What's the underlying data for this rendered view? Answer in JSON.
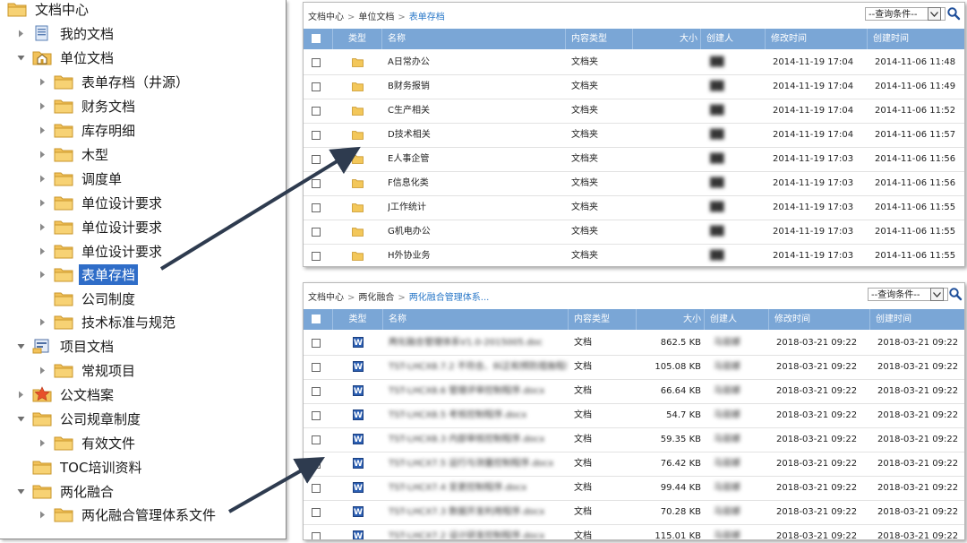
{
  "colors": {
    "header_bg": "#7aa6d6",
    "selection": "#2f6dc8",
    "link": "#2a78c8",
    "folder": "#f2c25a",
    "arrow": "#2e3b4f"
  },
  "tree": {
    "nodes": [
      {
        "label": "文档中心",
        "icon": "folder-icon",
        "caret": "none"
      },
      {
        "label": "我的文档",
        "icon": "my-documents-icon",
        "caret": "right"
      },
      {
        "label": "单位文档",
        "icon": "unit-documents-icon",
        "caret": "down"
      },
      {
        "label": "表单存档（井源）",
        "icon": "folder-icon",
        "caret": "right"
      },
      {
        "label": "财务文档",
        "icon": "folder-icon",
        "caret": "right"
      },
      {
        "label": "库存明细",
        "icon": "folder-icon",
        "caret": "right"
      },
      {
        "label": "木型",
        "icon": "folder-icon",
        "caret": "right"
      },
      {
        "label": "调度单",
        "icon": "folder-icon",
        "caret": "right"
      },
      {
        "label": "单位设计要求",
        "icon": "folder-icon",
        "caret": "right"
      },
      {
        "label": "单位设计要求",
        "icon": "folder-icon",
        "caret": "right"
      },
      {
        "label": "单位设计要求",
        "icon": "folder-icon",
        "caret": "right"
      },
      {
        "label": "表单存档",
        "icon": "folder-icon",
        "caret": "right",
        "selected": true
      },
      {
        "label": "公司制度",
        "icon": "folder-icon",
        "caret": "none"
      },
      {
        "label": "技术标准与规范",
        "icon": "folder-icon",
        "caret": "right"
      },
      {
        "label": "项目文档",
        "icon": "project-documents-icon",
        "caret": "down"
      },
      {
        "label": "常规项目",
        "icon": "folder-icon",
        "caret": "right"
      },
      {
        "label": "公文档案",
        "icon": "star-icon",
        "caret": "right"
      },
      {
        "label": "公司规章制度",
        "icon": "folder-icon",
        "caret": "down"
      },
      {
        "label": "有效文件",
        "icon": "folder-icon",
        "caret": "right"
      },
      {
        "label": "TOC培训资料",
        "icon": "folder-icon",
        "caret": "none"
      },
      {
        "label": "两化融合",
        "icon": "folder-icon",
        "caret": "down"
      },
      {
        "label": "两化融合管理体系文件",
        "icon": "folder-icon",
        "caret": "right"
      }
    ]
  },
  "panel1": {
    "breadcrumb": [
      "文档中心",
      "单位文档",
      "表单存档"
    ],
    "query_label": "--查询条件--",
    "columns": [
      "类型",
      "名称",
      "内容类型",
      "大小",
      "创建人",
      "修改时间",
      "创建时间"
    ],
    "rows": [
      {
        "name": "A日常办公",
        "content_type": "文档夹",
        "size": "",
        "creator": "██",
        "modified": "2014-11-19 17:04",
        "created": "2014-11-06 11:48"
      },
      {
        "name": "B财务报销",
        "content_type": "文档夹",
        "size": "",
        "creator": "██",
        "modified": "2014-11-19 17:04",
        "created": "2014-11-06 11:49"
      },
      {
        "name": "C生产相关",
        "content_type": "文档夹",
        "size": "",
        "creator": "██",
        "modified": "2014-11-19 17:04",
        "created": "2014-11-06 11:52"
      },
      {
        "name": "D技术相关",
        "content_type": "文档夹",
        "size": "",
        "creator": "██",
        "modified": "2014-11-19 17:04",
        "created": "2014-11-06 11:57"
      },
      {
        "name": "E人事企管",
        "content_type": "文档夹",
        "size": "",
        "creator": "██",
        "modified": "2014-11-19 17:03",
        "created": "2014-11-06 11:56"
      },
      {
        "name": "F信息化类",
        "content_type": "文档夹",
        "size": "",
        "creator": "██",
        "modified": "2014-11-19 17:03",
        "created": "2014-11-06 11:56"
      },
      {
        "name": "J工作统计",
        "content_type": "文档夹",
        "size": "",
        "creator": "██",
        "modified": "2014-11-19 17:03",
        "created": "2014-11-06 11:55"
      },
      {
        "name": "G机电办公",
        "content_type": "文档夹",
        "size": "",
        "creator": "██",
        "modified": "2014-11-19 17:03",
        "created": "2014-11-06 11:55"
      },
      {
        "name": "H外协业务",
        "content_type": "文档夹",
        "size": "",
        "creator": "██",
        "modified": "2014-11-19 17:03",
        "created": "2014-11-06 11:55"
      }
    ]
  },
  "panel2": {
    "breadcrumb": [
      "文档中心",
      "两化融合",
      "两化融合管理体系..."
    ],
    "query_label": "--查询条件--",
    "columns": [
      "类型",
      "名称",
      "内容类型",
      "大小",
      "创建人",
      "修改时间",
      "创建时间"
    ],
    "rows": [
      {
        "name": "两化融合管理体系V1.0-2015005.doc",
        "content_type": "文档",
        "size": "862.5 KB",
        "creator": "马丽娜",
        "modified": "2018-03-21 09:22",
        "created": "2018-03-21 09:22"
      },
      {
        "name": "TST-LHCX8.7.2 不符合、纠正和预防措施程序.doc",
        "content_type": "文档",
        "size": "105.08 KB",
        "creator": "马丽娜",
        "modified": "2018-03-21 09:22",
        "created": "2018-03-21 09:22"
      },
      {
        "name": "TST-LHCX8.6 管理评审控制程序.docx",
        "content_type": "文档",
        "size": "66.64 KB",
        "creator": "马丽娜",
        "modified": "2018-03-21 09:22",
        "created": "2018-03-21 09:22"
      },
      {
        "name": "TST-LHCX8.5 考核控制程序.docx",
        "content_type": "文档",
        "size": "54.7 KB",
        "creator": "马丽娜",
        "modified": "2018-03-21 09:22",
        "created": "2018-03-21 09:22"
      },
      {
        "name": "TST-LHCX8.3 内部审核控制程序.docx",
        "content_type": "文档",
        "size": "59.35 KB",
        "creator": "马丽娜",
        "modified": "2018-03-21 09:22",
        "created": "2018-03-21 09:22"
      },
      {
        "name": "TST-LHCX7.5 运行与测量控制程序.docx",
        "content_type": "文档",
        "size": "76.42 KB",
        "creator": "马丽娜",
        "modified": "2018-03-21 09:22",
        "created": "2018-03-21 09:22"
      },
      {
        "name": "TST-LHCX7.4 变更控制程序.docx",
        "content_type": "文档",
        "size": "99.44 KB",
        "creator": "马丽娜",
        "modified": "2018-03-21 09:22",
        "created": "2018-03-21 09:22"
      },
      {
        "name": "TST-LHCX7.3 数据开发利用程序.docx",
        "content_type": "文档",
        "size": "70.28 KB",
        "creator": "马丽娜",
        "modified": "2018-03-21 09:22",
        "created": "2018-03-21 09:22"
      },
      {
        "name": "TST-LHCX7.2 设计研发控制程序.docx",
        "content_type": "文档",
        "size": "115.01 KB",
        "creator": "马丽娜",
        "modified": "2018-03-21 09:22",
        "created": "2018-03-21 09:22"
      }
    ]
  }
}
